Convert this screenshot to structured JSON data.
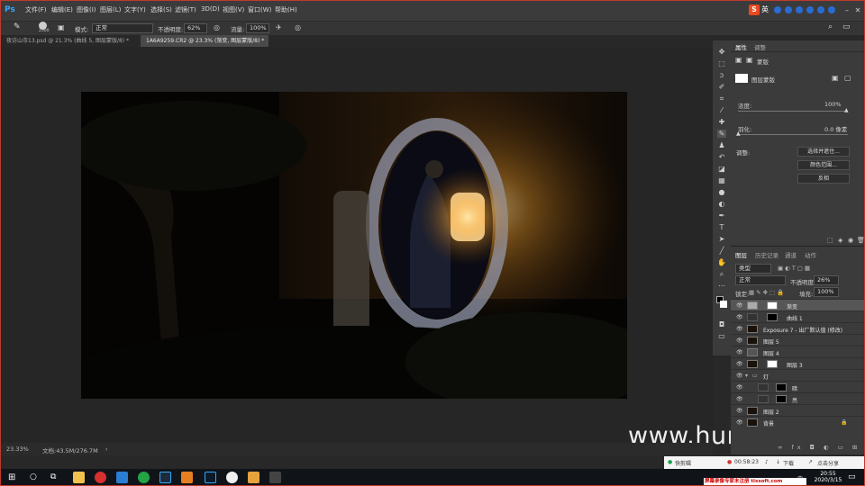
{
  "app": {
    "logo": "Ps"
  },
  "menu": [
    "文件(F)",
    "编辑(E)",
    "图像(I)",
    "图层(L)",
    "文字(Y)",
    "选择(S)",
    "滤镜(T)",
    "3D(D)",
    "视图(V)",
    "窗口(W)",
    "帮助(H)"
  ],
  "tray_top": {
    "ime_label": "英"
  },
  "options_bar": {
    "brush_size": "2500",
    "mode_label": "模式:",
    "mode_value": "正常",
    "opacity_label": "不透明度:",
    "opacity_value": "62%",
    "flow_label": "流量:",
    "flow_value": "100%"
  },
  "tabs": [
    {
      "label": "夜访山寺13.psd @ 21.3% (曲线 5, 图层蒙版/8) *",
      "active": false
    },
    {
      "label": "1A6A9259.CR2 @ 23.3% (渐变, 图层蒙版/8) *",
      "active": true
    }
  ],
  "status_bar": {
    "zoom": "23.33%",
    "doc": "文档:43.5M/276.7M"
  },
  "properties_panel": {
    "tabs": [
      "属性",
      "调整"
    ],
    "mask_title": "蒙版",
    "layer_mask_label": "图层蒙版",
    "density_label": "浓度:",
    "density_value": "100%",
    "feather_label": "羽化:",
    "feather_value": "0.0 像素",
    "refine_label": "调整:",
    "buttons": [
      "选择并遮住...",
      "颜色范围...",
      "反相"
    ]
  },
  "layers_panel": {
    "tabs": [
      "图层",
      "历史记录",
      "通道",
      "动作"
    ],
    "filter_label": "类型",
    "blend_mode": "正常",
    "opacity_label": "不透明度:",
    "opacity_value": "26%",
    "lock_label": "锁定:",
    "fill_label": "填充:",
    "fill_value": "100%",
    "layers": [
      {
        "name": "渐变",
        "selected": true,
        "indent": 0
      },
      {
        "name": "曲线 1",
        "selected": false,
        "indent": 0
      },
      {
        "name": "Exposure 7 - 出厂默认值 (修改)",
        "selected": false,
        "indent": 0
      },
      {
        "name": "图层 5",
        "selected": false,
        "indent": 0
      },
      {
        "name": "图层 4",
        "selected": false,
        "indent": 0
      },
      {
        "name": "图层 3",
        "selected": false,
        "indent": 0
      },
      {
        "name": "灯",
        "selected": false,
        "indent": 0
      },
      {
        "name": "暗",
        "selected": false,
        "indent": 1
      },
      {
        "name": "亮",
        "selected": false,
        "indent": 1
      },
      {
        "name": "图层 2",
        "selected": false,
        "indent": 0
      },
      {
        "name": "背景",
        "selected": false,
        "indent": 0
      }
    ]
  },
  "notify_bar": {
    "capture": "快剪辑",
    "timer": "00:58:23",
    "download": "下载",
    "share": "点击分享"
  },
  "taskbar": {
    "time": "20:55",
    "date": "2020/3/15",
    "lang": "中"
  },
  "watermark": "www.hunls.com",
  "banner": "屏幕录像专家未注册 tlxsoft.com",
  "colors": {
    "accent": "#31a8ff",
    "lantern": "#ffcf6a",
    "record": "#d63031"
  }
}
